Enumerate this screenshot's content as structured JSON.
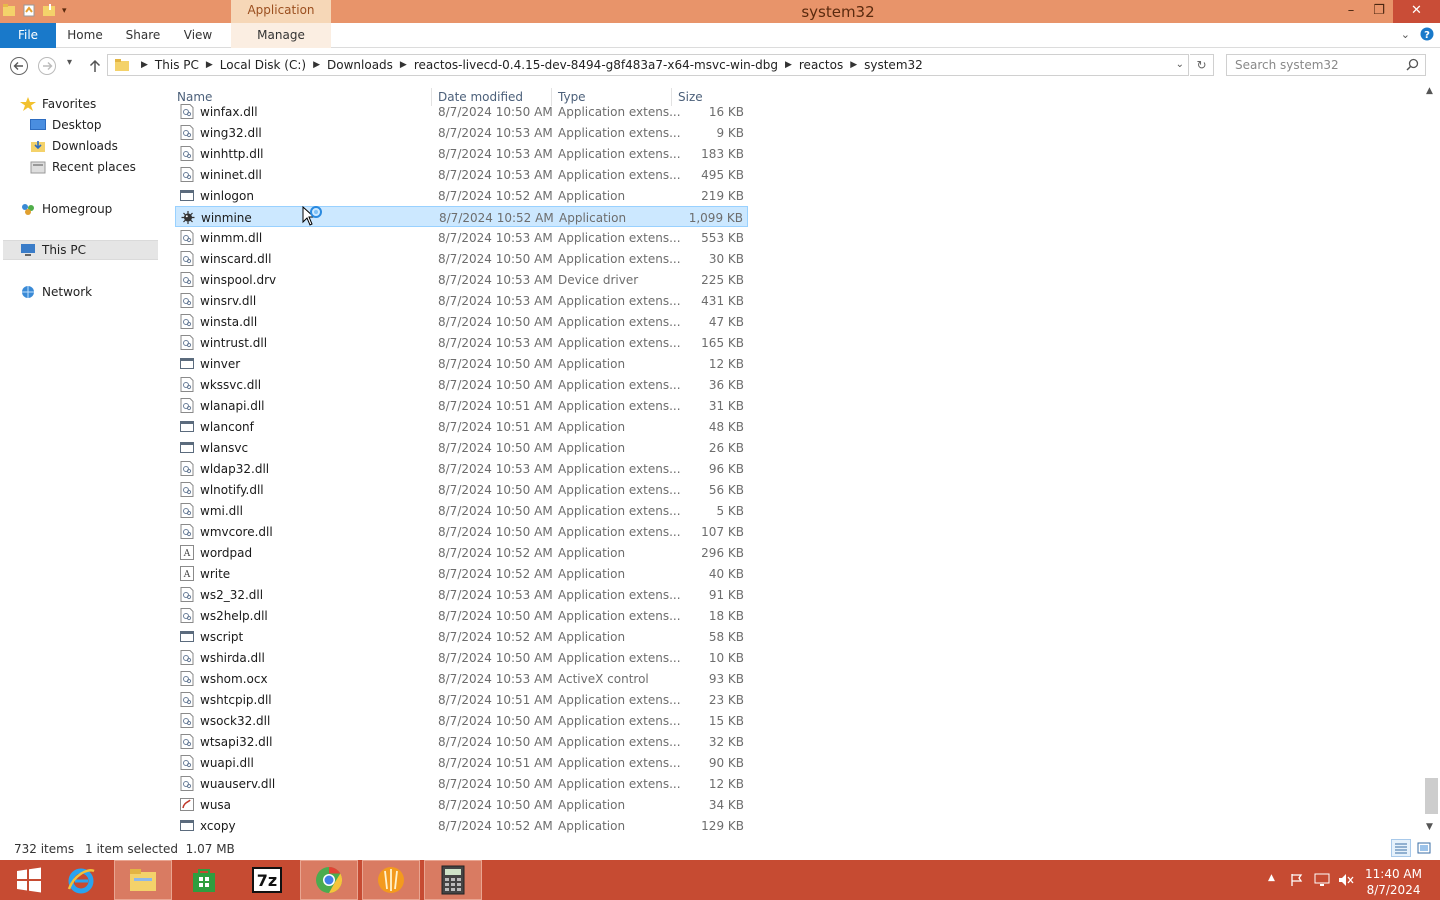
{
  "window": {
    "title": "system32",
    "contextual_tab": "Application Tools",
    "minimize": "–",
    "maximize": "❐",
    "close": "✕"
  },
  "ribbon": {
    "tabs": [
      "File",
      "Home",
      "Share",
      "View",
      "Manage"
    ]
  },
  "address": {
    "crumbs": [
      "This PC",
      "Local Disk (C:)",
      "Downloads",
      "reactos-livecd-0.4.15-dev-8494-g8f483a7-x64-msvc-win-dbg",
      "reactos",
      "system32"
    ],
    "search_placeholder": "Search system32"
  },
  "nav": {
    "favorites": "Favorites",
    "desktop": "Desktop",
    "downloads": "Downloads",
    "recent": "Recent places",
    "homegroup": "Homegroup",
    "thispc": "This PC",
    "network": "Network"
  },
  "columns": {
    "name": "Name",
    "date": "Date modified",
    "type": "Type",
    "size": "Size"
  },
  "files": [
    {
      "name": "winfax.dll",
      "date": "8/7/2024 10:50 AM",
      "type": "Application extens...",
      "size": "16 KB",
      "icon": "dll-icon"
    },
    {
      "name": "wing32.dll",
      "date": "8/7/2024 10:53 AM",
      "type": "Application extens...",
      "size": "9 KB",
      "icon": "dll-icon"
    },
    {
      "name": "winhttp.dll",
      "date": "8/7/2024 10:53 AM",
      "type": "Application extens...",
      "size": "183 KB",
      "icon": "dll-icon"
    },
    {
      "name": "wininet.dll",
      "date": "8/7/2024 10:53 AM",
      "type": "Application extens...",
      "size": "495 KB",
      "icon": "dll-icon"
    },
    {
      "name": "winlogon",
      "date": "8/7/2024 10:52 AM",
      "type": "Application",
      "size": "219 KB",
      "icon": "app-icon"
    },
    {
      "name": "winmine",
      "date": "8/7/2024 10:52 AM",
      "type": "Application",
      "size": "1,099 KB",
      "icon": "mine-icon",
      "selected": true
    },
    {
      "name": "winmm.dll",
      "date": "8/7/2024 10:53 AM",
      "type": "Application extens...",
      "size": "553 KB",
      "icon": "dll-icon"
    },
    {
      "name": "winscard.dll",
      "date": "8/7/2024 10:50 AM",
      "type": "Application extens...",
      "size": "30 KB",
      "icon": "dll-icon"
    },
    {
      "name": "winspool.drv",
      "date": "8/7/2024 10:53 AM",
      "type": "Device driver",
      "size": "225 KB",
      "icon": "dll-icon"
    },
    {
      "name": "winsrv.dll",
      "date": "8/7/2024 10:53 AM",
      "type": "Application extens...",
      "size": "431 KB",
      "icon": "dll-icon"
    },
    {
      "name": "winsta.dll",
      "date": "8/7/2024 10:50 AM",
      "type": "Application extens...",
      "size": "47 KB",
      "icon": "dll-icon"
    },
    {
      "name": "wintrust.dll",
      "date": "8/7/2024 10:53 AM",
      "type": "Application extens...",
      "size": "165 KB",
      "icon": "dll-icon"
    },
    {
      "name": "winver",
      "date": "8/7/2024 10:50 AM",
      "type": "Application",
      "size": "12 KB",
      "icon": "app-icon"
    },
    {
      "name": "wkssvc.dll",
      "date": "8/7/2024 10:50 AM",
      "type": "Application extens...",
      "size": "36 KB",
      "icon": "dll-icon"
    },
    {
      "name": "wlanapi.dll",
      "date": "8/7/2024 10:51 AM",
      "type": "Application extens...",
      "size": "31 KB",
      "icon": "dll-icon"
    },
    {
      "name": "wlanconf",
      "date": "8/7/2024 10:51 AM",
      "type": "Application",
      "size": "48 KB",
      "icon": "app-icon"
    },
    {
      "name": "wlansvc",
      "date": "8/7/2024 10:50 AM",
      "type": "Application",
      "size": "26 KB",
      "icon": "app-icon"
    },
    {
      "name": "wldap32.dll",
      "date": "8/7/2024 10:53 AM",
      "type": "Application extens...",
      "size": "96 KB",
      "icon": "dll-icon"
    },
    {
      "name": "wlnotify.dll",
      "date": "8/7/2024 10:50 AM",
      "type": "Application extens...",
      "size": "56 KB",
      "icon": "dll-icon"
    },
    {
      "name": "wmi.dll",
      "date": "8/7/2024 10:50 AM",
      "type": "Application extens...",
      "size": "5 KB",
      "icon": "dll-icon"
    },
    {
      "name": "wmvcore.dll",
      "date": "8/7/2024 10:50 AM",
      "type": "Application extens...",
      "size": "107 KB",
      "icon": "dll-icon"
    },
    {
      "name": "wordpad",
      "date": "8/7/2024 10:52 AM",
      "type": "Application",
      "size": "296 KB",
      "icon": "wordpad-icon"
    },
    {
      "name": "write",
      "date": "8/7/2024 10:52 AM",
      "type": "Application",
      "size": "40 KB",
      "icon": "wordpad-icon"
    },
    {
      "name": "ws2_32.dll",
      "date": "8/7/2024 10:53 AM",
      "type": "Application extens...",
      "size": "91 KB",
      "icon": "dll-icon"
    },
    {
      "name": "ws2help.dll",
      "date": "8/7/2024 10:50 AM",
      "type": "Application extens...",
      "size": "18 KB",
      "icon": "dll-icon"
    },
    {
      "name": "wscript",
      "date": "8/7/2024 10:52 AM",
      "type": "Application",
      "size": "58 KB",
      "icon": "app-icon"
    },
    {
      "name": "wshirda.dll",
      "date": "8/7/2024 10:50 AM",
      "type": "Application extens...",
      "size": "10 KB",
      "icon": "dll-icon"
    },
    {
      "name": "wshom.ocx",
      "date": "8/7/2024 10:53 AM",
      "type": "ActiveX control",
      "size": "93 KB",
      "icon": "dll-icon"
    },
    {
      "name": "wshtcpip.dll",
      "date": "8/7/2024 10:51 AM",
      "type": "Application extens...",
      "size": "23 KB",
      "icon": "dll-icon"
    },
    {
      "name": "wsock32.dll",
      "date": "8/7/2024 10:50 AM",
      "type": "Application extens...",
      "size": "15 KB",
      "icon": "dll-icon"
    },
    {
      "name": "wtsapi32.dll",
      "date": "8/7/2024 10:50 AM",
      "type": "Application extens...",
      "size": "32 KB",
      "icon": "dll-icon"
    },
    {
      "name": "wuapi.dll",
      "date": "8/7/2024 10:51 AM",
      "type": "Application extens...",
      "size": "90 KB",
      "icon": "dll-icon"
    },
    {
      "name": "wuauserv.dll",
      "date": "8/7/2024 10:50 AM",
      "type": "Application extens...",
      "size": "12 KB",
      "icon": "dll-icon"
    },
    {
      "name": "wusa",
      "date": "8/7/2024 10:50 AM",
      "type": "Application",
      "size": "34 KB",
      "icon": "setup-icon"
    },
    {
      "name": "xcopy",
      "date": "8/7/2024 10:52 AM",
      "type": "Application",
      "size": "129 KB",
      "icon": "app-icon"
    }
  ],
  "status": {
    "count": "732 items",
    "selection": "1 item selected  1.07 MB"
  },
  "taskbar": {
    "apps": [
      "start-icon",
      "internet-explorer-icon",
      "file-explorer-icon",
      "store-icon",
      "7zip-icon",
      "chrome-icon",
      "media-icon",
      "calculator-icon"
    ],
    "seven_zip_label": "7z",
    "time": "11:40 AM",
    "date": "8/7/2024"
  },
  "colors": {
    "titlebar": "#e8946a",
    "taskbar": "#c64b32",
    "selection": "#cce8ff",
    "accent": "#1979ca"
  }
}
